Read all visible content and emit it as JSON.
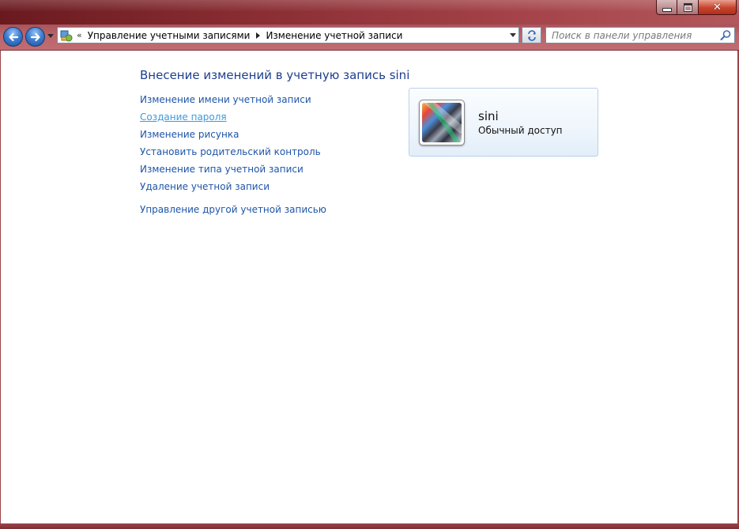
{
  "window": {
    "controls": {
      "close_glyph": "✕"
    }
  },
  "navigation": {
    "breadcrumb_prefix": "«",
    "breadcrumb": [
      "Управление учетными записями",
      "Изменение учетной записи"
    ],
    "search_placeholder": "Поиск в панели управления"
  },
  "main": {
    "heading": "Внесение изменений в учетную запись sini",
    "links": [
      {
        "label": "Изменение имени учетной записи",
        "state": "normal"
      },
      {
        "label": "Создание пароля",
        "state": "hover"
      },
      {
        "label": "Изменение рисунка",
        "state": "normal"
      },
      {
        "label": "Установить родительский контроль",
        "state": "normal"
      },
      {
        "label": "Изменение типа учетной записи",
        "state": "normal"
      },
      {
        "label": "Удаление учетной записи",
        "state": "normal"
      }
    ],
    "other_link": "Управление другой учетной записью"
  },
  "account_card": {
    "username": "sini",
    "account_type": "Обычный доступ"
  },
  "colors": {
    "titlebar": "#8a2e33",
    "link": "#1e55a8",
    "link_hover": "#3c9bdc",
    "heading": "#1e3f8f",
    "card_border": "#b9d1ea"
  }
}
